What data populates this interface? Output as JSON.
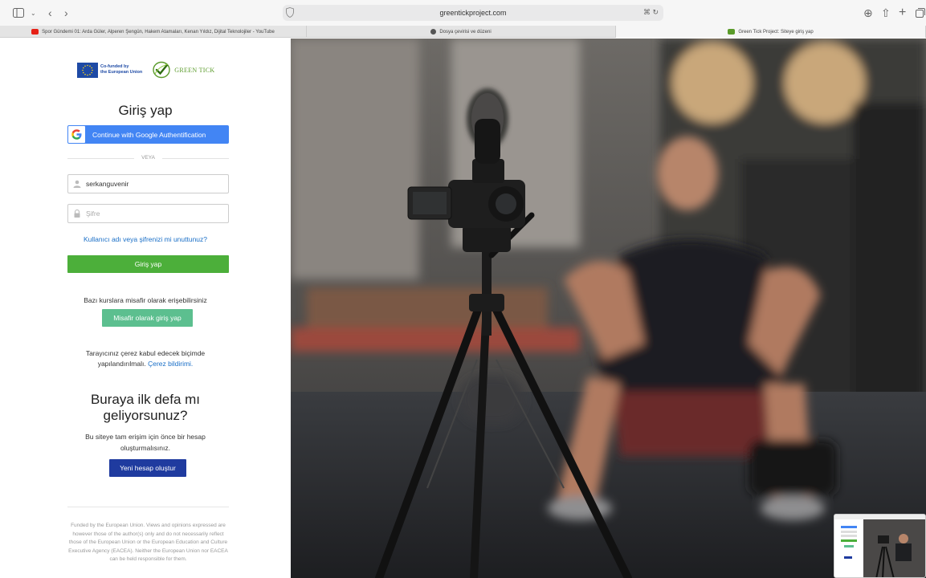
{
  "browser": {
    "url": "greentickproject.com",
    "tabs": [
      {
        "label": "Spor Gündemi 01: Arda Güler, Alperen Şengün, Hakem Atamaları, Kenan Yıldız, Dijital Teknolojiler - YouTube",
        "favicon_color": "#e62117"
      },
      {
        "label": "Dosya çevirisi ve düzeni",
        "favicon_color": "#333333"
      },
      {
        "label": "Green Tick Project: Siteye giriş yap",
        "favicon_color": "#5a9b2a"
      }
    ],
    "icons": [
      "sidebar-icon",
      "chevron-down-icon",
      "back-icon",
      "forward-icon",
      "shield-icon",
      "translate-icon",
      "reload-icon",
      "download-icon",
      "share-icon",
      "new-tab-icon",
      "tab-overview-icon"
    ]
  },
  "logos": {
    "eu_line1": "Co-funded by",
    "eu_line2": "the European Union",
    "green_tick": "GREEN TICK"
  },
  "login": {
    "title": "Giriş yap",
    "google_button": "Continue with Google Authentification",
    "divider": "VEYA",
    "username_value": "serkanguvenir",
    "password_placeholder": "Şifre",
    "forgot_link": "Kullanıcı adı veya şifrenizi mi unuttunuz?",
    "login_button": "Giriş yap",
    "guest_text": "Bazı kurslara misafir olarak erişebilirsiniz",
    "guest_button": "Misafir olarak giriş yap",
    "cookie_line1": "Tarayıcınız çerez kabul edecek biçimde",
    "cookie_line2": "yapılandırılmalı.",
    "cookie_link": "Çerez bildirimi."
  },
  "signup": {
    "title_line1": "Buraya ilk defa mı",
    "title_line2": "geliyorsunuz?",
    "desc_line1": "Bu siteye tam erişim için önce bir hesap",
    "desc_line2": "oluşturmalısınız.",
    "button": "Yeni hesap oluştur"
  },
  "disclaimer": "Funded by the European Union. Views and opinions expressed are however those of the author(s) only and do not necessarily reflect those of the European Union or the European Education and Culture Executive Agency (EACEA). Neither the European Union nor EACEA can be held responsible for them.",
  "colors": {
    "google_blue": "#4285f4",
    "login_green": "#4caf3a",
    "guest_green": "#5cbf8f",
    "signup_blue": "#1f3b9f",
    "link_blue": "#1a6fc7"
  }
}
